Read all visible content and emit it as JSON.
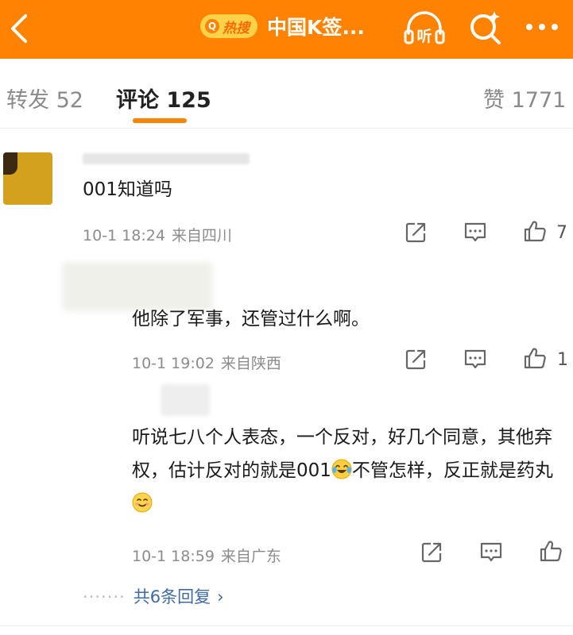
{
  "header": {
    "hot_badge_label": "热搜",
    "title": "中国K签...",
    "brand_color": "#ff8200"
  },
  "tabs": {
    "repost": "转发 52",
    "comment": "评论 125",
    "like": "赞 1771",
    "active": "comment"
  },
  "comments": [
    {
      "text": "001知道吗",
      "time": "10-1 18:24",
      "location": "来自四川",
      "likes": "7"
    },
    {
      "text": "他除了军事，还管过什么啊。",
      "time": "10-1 19:02",
      "location": "来自陕西",
      "likes": "1"
    },
    {
      "text_part1": "听说七八个人表态，一个反对，好几个同意，其他弃权，估计反对的就是001",
      "text_part2": "不管怎样，反正就是药丸",
      "time": "10-1 18:59",
      "location": "来自广东",
      "likes": ""
    }
  ],
  "more_replies": "共6条回复",
  "icons": [
    "back-icon",
    "listen-icon",
    "search-icon",
    "more-icon",
    "share-icon",
    "comment-icon",
    "like-icon",
    "laugh-cry-emoji-icon",
    "smile-emoji-icon"
  ]
}
